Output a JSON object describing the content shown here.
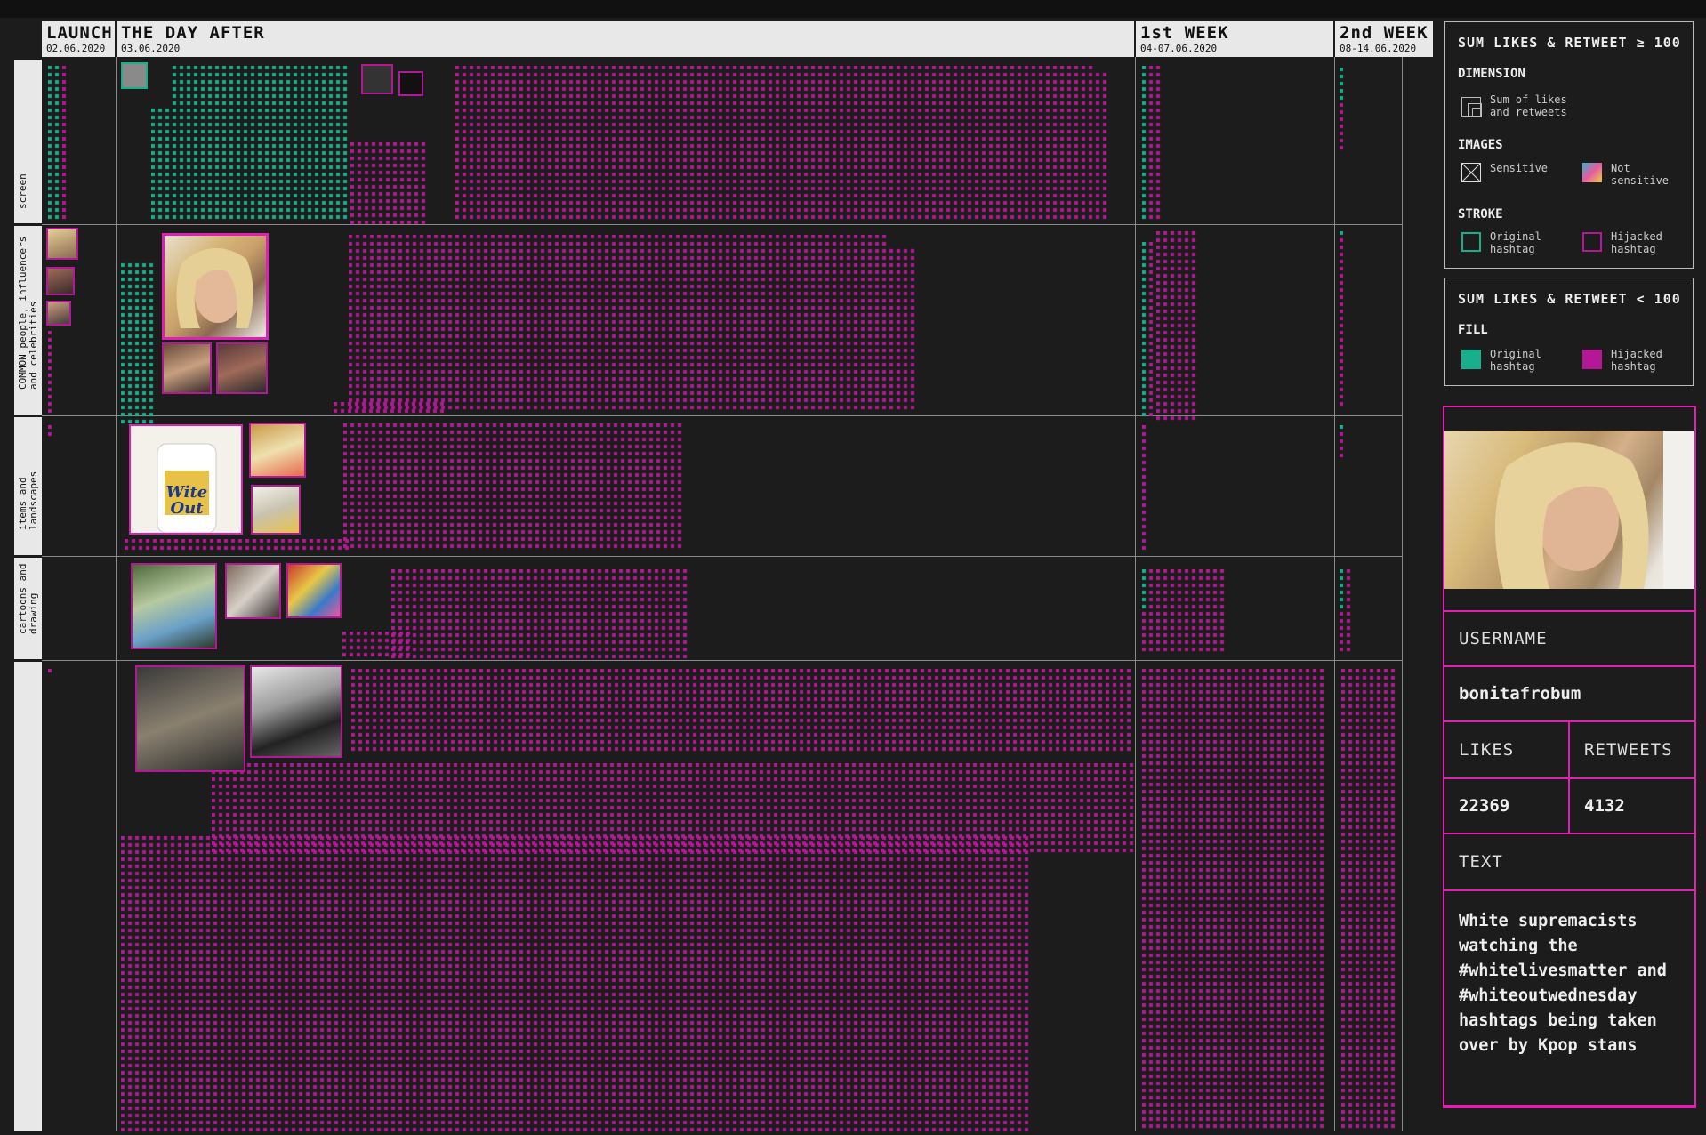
{
  "colors": {
    "original": "#18b08c",
    "hijacked": "#b41896",
    "accent": "#e020b4",
    "background": "#1c1c1c"
  },
  "columns": [
    {
      "title": "LAUNCH",
      "date": "02.06.2020"
    },
    {
      "title": "THE DAY AFTER",
      "date": "03.06.2020"
    },
    {
      "title": "1st WEEK",
      "date": "04-07.06.2020"
    },
    {
      "title": "2nd WEEK",
      "date": "08-14.06.2020"
    }
  ],
  "rows": [
    {
      "label": "screen"
    },
    {
      "label": "COMMON people, influencers\nand celebrities"
    },
    {
      "label": "items and\nlandscapes"
    },
    {
      "label": "cartoons and\ndrawing"
    },
    {
      "label": ""
    }
  ],
  "legend_high": {
    "title": "SUM LIKES & RETWEET ≥ 100",
    "dimension_heading": "DIMENSION",
    "dimension_item": "Sum of likes\nand retweets",
    "images_heading": "IMAGES",
    "sensitive_label": "Sensitive",
    "not_sensitive_label": "Not\nsensitive",
    "stroke_heading": "STROKE",
    "original_label": "Original\nhashtag",
    "hijacked_label": "Hijacked\nhashtag"
  },
  "legend_low": {
    "title": "SUM LIKES & RETWEET < 100",
    "fill_heading": "FILL",
    "original_label": "Original\nhashtag",
    "hijacked_label": "Hijacked\nhashtag"
  },
  "detail": {
    "username_label": "USERNAME",
    "username": "bonitafrobum",
    "likes_label": "LIKES",
    "retweets_label": "RETWEETS",
    "likes": "22369",
    "retweets": "4132",
    "text_label": "TEXT",
    "text": "White supremacists watching the #whitelivesmatter and #whiteoutwednesday hashtags being taken over by Kpop stans"
  }
}
